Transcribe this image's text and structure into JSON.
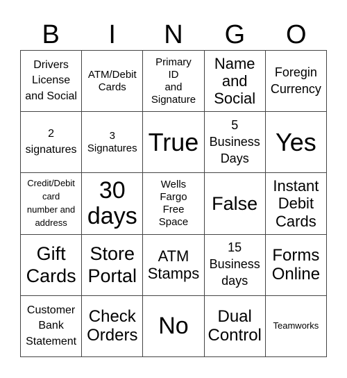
{
  "header": [
    "B",
    "I",
    "N",
    "G",
    "O"
  ],
  "cells": [
    "Drivers\nLicense\nand Social",
    "ATM/Debit\nCards",
    "Primary\nID\nand\nSignature",
    "Name\nand\nSocial",
    "Foregin\nCurrency",
    "2\nsignatures",
    "3\nSignatures",
    "True",
    "5\nBusiness\nDays",
    "Yes",
    "Credit/Debit\ncard\nnumber and\naddress",
    "30\ndays",
    "Wells\nFargo\nFree\nSpace",
    "False",
    "Instant\nDebit\nCards",
    "Gift\nCards",
    "Store\nPortal",
    "ATM\nStamps",
    "15\nBusiness\ndays",
    "Forms\nOnline",
    "Customer\nBank\nStatement",
    "Check\nOrders",
    "No",
    "Dual\nControl",
    "Teamworks"
  ]
}
